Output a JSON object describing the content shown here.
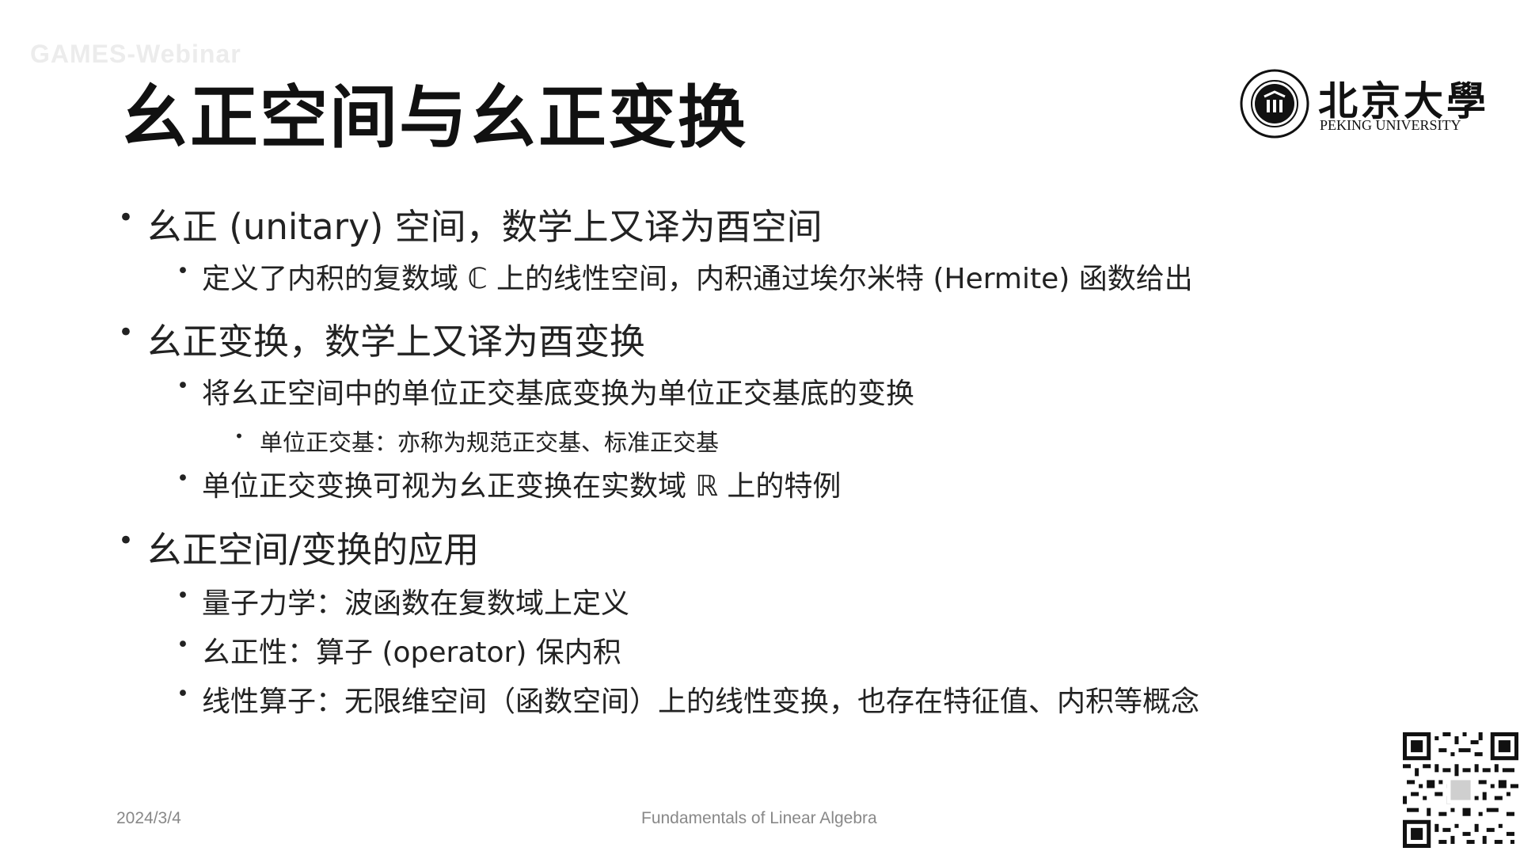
{
  "watermark": "GAMES-Webinar",
  "title": "幺正空间与幺正变换",
  "logo": {
    "chinese": "北京大學",
    "english": "PEKING UNIVERSITY"
  },
  "bullets": [
    {
      "level": 1,
      "text": "幺正 (unitary) 空间，数学上又译为酉空间"
    },
    {
      "level": 2,
      "text": "定义了内积的复数域 ℂ 上的线性空间，内积通过埃尔米特 (Hermite) 函数给出"
    },
    {
      "level": 1,
      "text": "幺正变换，数学上又译为酉变换"
    },
    {
      "level": 2,
      "text": "将幺正空间中的单位正交基底变换为单位正交基底的变换"
    },
    {
      "level": 3,
      "text": "单位正交基：亦称为规范正交基、标准正交基"
    },
    {
      "level": 2,
      "text": "单位正交变换可视为幺正变换在实数域 ℝ 上的特例"
    },
    {
      "level": 1,
      "text": "幺正空间/变换的应用"
    },
    {
      "level": 2,
      "text": "量子力学：波函数在复数域上定义"
    },
    {
      "level": 2,
      "text": "幺正性：算子 (operator) 保内积"
    },
    {
      "level": 2,
      "text": "线性算子：无限维空间（函数空间）上的线性变换，也存在特征值、内积等概念"
    }
  ],
  "footer": {
    "date": "2024/3/4",
    "course": "Fundamentals of Linear Algebra"
  },
  "icons": {
    "logo_emblem": "university-seal-icon",
    "qr": "qr-code-icon"
  }
}
